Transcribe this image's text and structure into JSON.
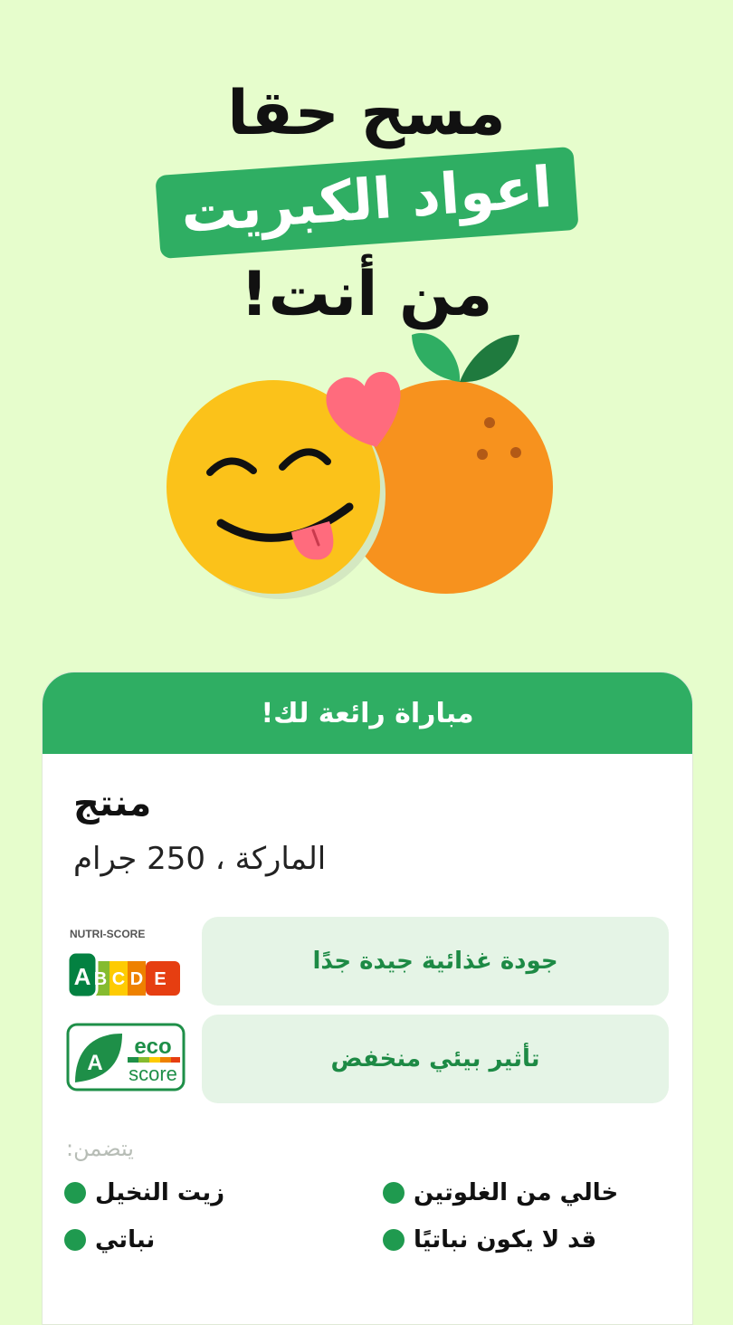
{
  "headline": {
    "line1": "مسح حقا",
    "line2": "اعواد الكبريت",
    "line3": "من أنت!"
  },
  "illustration": {
    "name": "smiley-and-orange-illustration"
  },
  "card": {
    "header": "مباراة رائعة لك!",
    "product_name": "منتج",
    "product_details": "الماركة ، 250 جرام",
    "nutri_score": {
      "logo_label": "NUTRI-SCORE",
      "grade": "A",
      "letters": [
        "A",
        "B",
        "C",
        "D",
        "E"
      ],
      "description": "جودة غذائية جيدة جدًا"
    },
    "eco_score": {
      "logo_word1": "eco",
      "logo_word2": "score",
      "grade": "A",
      "description": "تأثير بيئي منخفض"
    },
    "includes_label": "يتضمن:",
    "tags": [
      "زيت النخيل",
      "خالي من الغلوتين",
      "نباتي",
      "قد لا يكون نباتيًا"
    ]
  },
  "colors": {
    "background": "#e6fdcc",
    "accent": "#2fae63",
    "pill_bg": "#e5f4e6",
    "pill_text": "#1d8a45"
  }
}
